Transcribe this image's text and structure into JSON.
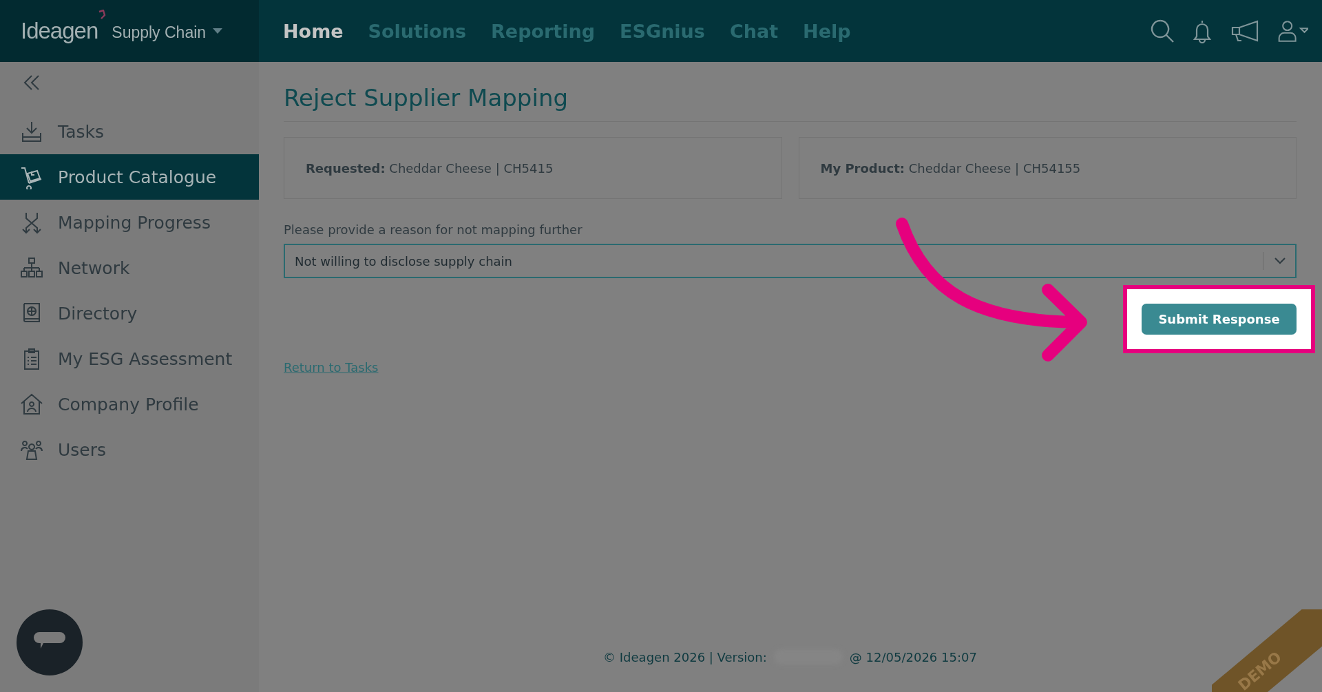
{
  "brand": {
    "name": "Ideagen",
    "product": "Supply Chain"
  },
  "nav": [
    {
      "label": "Home",
      "selected": true
    },
    {
      "label": "Solutions",
      "selected": false
    },
    {
      "label": "Reporting",
      "selected": false
    },
    {
      "label": "ESGnius",
      "selected": false
    },
    {
      "label": "Chat",
      "selected": false
    },
    {
      "label": "Help",
      "selected": false
    }
  ],
  "sidebar": {
    "items": [
      {
        "label": "Tasks",
        "selected": false
      },
      {
        "label": "Product Catalogue",
        "selected": true
      },
      {
        "label": "Mapping Progress",
        "selected": false
      },
      {
        "label": "Network",
        "selected": false
      },
      {
        "label": "Directory",
        "selected": false
      },
      {
        "label": "My ESG Assessment",
        "selected": false
      },
      {
        "label": "Company Profile",
        "selected": false
      },
      {
        "label": "Users",
        "selected": false
      }
    ]
  },
  "page": {
    "title": "Reject Supplier Mapping",
    "cards": [
      {
        "label": "Requested:",
        "value": "Cheddar Cheese | CH5415"
      },
      {
        "label": "My Product:",
        "value": "Cheddar Cheese | CH54155"
      }
    ],
    "reason": {
      "label": "Please provide a reason for not mapping further",
      "value": "Not willing to disclose supply chain"
    },
    "submit": "Submit Response",
    "return_link": "Return to Tasks"
  },
  "footer": {
    "left": "© Ideagen 2026 | Version:",
    "right": "@ 12/05/2026 15:07"
  },
  "ribbon": "DEMO"
}
